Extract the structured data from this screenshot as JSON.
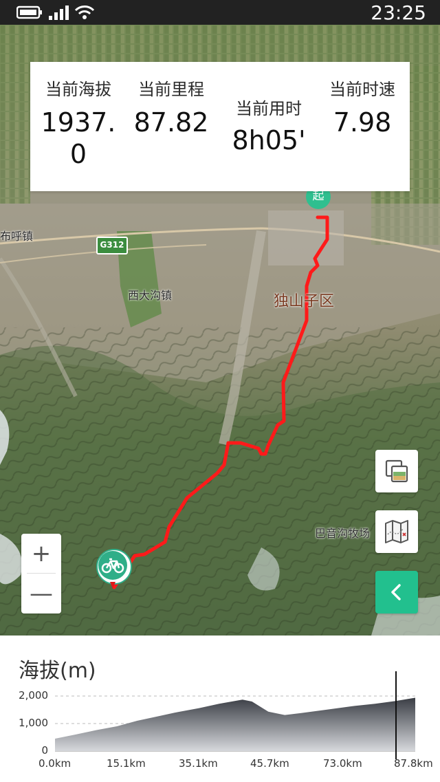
{
  "status_bar": {
    "time": "23:25",
    "icons": [
      "battery-icon",
      "signal-icon",
      "wifi-icon"
    ]
  },
  "map": {
    "labels": {
      "bubu": "布呼镇",
      "xidagou": "西大沟镇",
      "dushanzi": "独山子区",
      "bayin": "巴音沟牧场"
    },
    "road_shield": "G312",
    "start_marker": "起",
    "route_color": "#ff1a1a"
  },
  "stats": {
    "altitude_label": "当前海拔",
    "altitude_value": "1937.0",
    "distance_label": "当前里程",
    "distance_value": "87.82",
    "time_label": "当前用时",
    "time_value": "8h05'",
    "speed_label": "当前时速",
    "speed_value": "7.98"
  },
  "controls": {
    "zoom_in": "+",
    "zoom_out": "—",
    "accent": "#22c08e"
  },
  "elevation": {
    "title": "海拔(m)",
    "y_ticks": [
      "2,000",
      "1,000",
      "0"
    ],
    "x_ticks": [
      "0.0km",
      "15.1km",
      "35.1km",
      "45.7km",
      "73.0km",
      "87.8km"
    ]
  },
  "chart_data": {
    "type": "area",
    "xlabel": "",
    "ylabel": "海拔(m)",
    "ylim": [
      0,
      2000
    ],
    "x": [
      0,
      5,
      10,
      15.1,
      20,
      25,
      30,
      35.1,
      40,
      45.7,
      48,
      52,
      56,
      60,
      66,
      73,
      78,
      83,
      87.8
    ],
    "values": [
      450,
      600,
      760,
      900,
      1100,
      1260,
      1420,
      1560,
      1720,
      1870,
      1800,
      1430,
      1310,
      1380,
      1500,
      1640,
      1720,
      1820,
      1937
    ],
    "cursor_x": 87.8
  }
}
